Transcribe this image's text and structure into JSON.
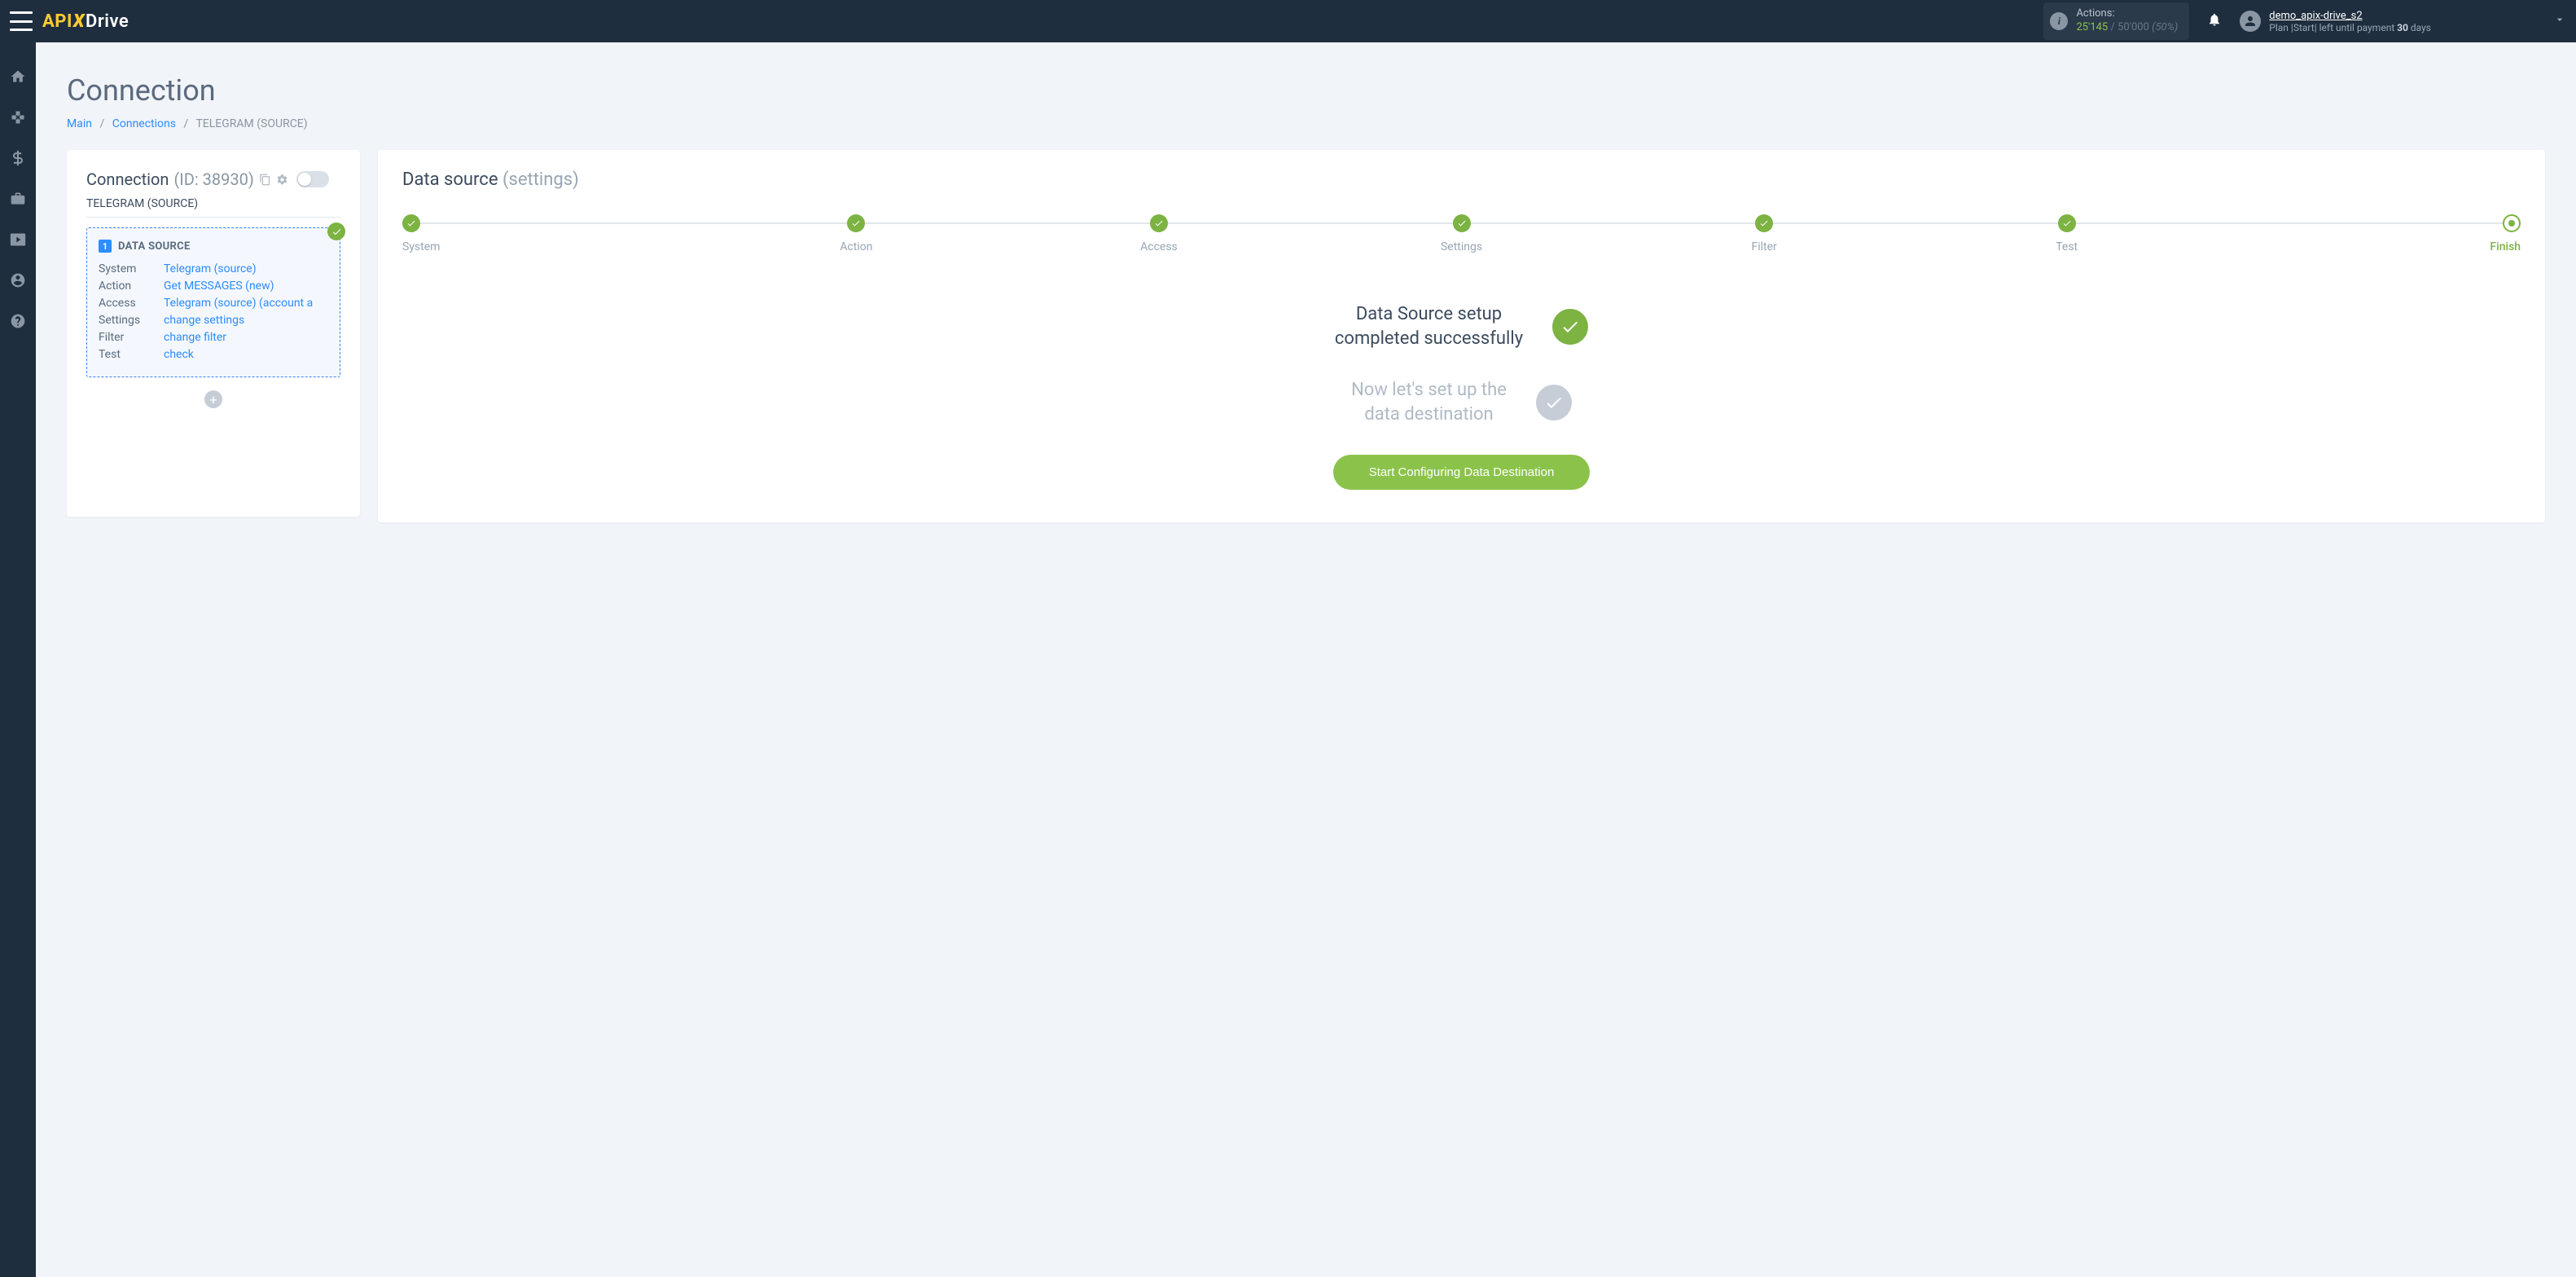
{
  "header": {
    "logo": {
      "part1": "API",
      "part2": "X",
      "part3": "Drive"
    },
    "actions": {
      "label": "Actions:",
      "used": "25'145",
      "sep": "/",
      "total": "50'000",
      "pct": "(50%)"
    },
    "user": {
      "name": "demo_apix-drive_s2",
      "plan_prefix": "Plan |",
      "plan_name": "Start",
      "plan_suffix": "| left until payment ",
      "plan_days": "30",
      "plan_unit": " days"
    }
  },
  "page": {
    "title": "Connection",
    "crumbs": {
      "main": "Main",
      "connections": "Connections",
      "current": "TELEGRAM (SOURCE)"
    }
  },
  "left": {
    "title": "Connection ",
    "id": "(ID: 38930)",
    "subtitle": "TELEGRAM (SOURCE)",
    "ds_title": "DATA SOURCE",
    "rows": [
      {
        "k": "System",
        "v": "Telegram (source)"
      },
      {
        "k": "Action",
        "v": "Get MESSAGES (new)"
      },
      {
        "k": "Access",
        "v": "Telegram (source) (account a"
      },
      {
        "k": "Settings",
        "v": "change settings"
      },
      {
        "k": "Filter",
        "v": "change filter"
      },
      {
        "k": "Test",
        "v": "check"
      }
    ]
  },
  "right": {
    "title": "Data source ",
    "title_muted": "(settings)",
    "steps": [
      "System",
      "Action",
      "Access",
      "Settings",
      "Filter",
      "Test",
      "Finish"
    ],
    "msg1_l1": "Data Source setup",
    "msg1_l2": "completed successfully",
    "msg2_l1": "Now let's set up the",
    "msg2_l2": "data destination",
    "cta": "Start Configuring Data Destination"
  }
}
